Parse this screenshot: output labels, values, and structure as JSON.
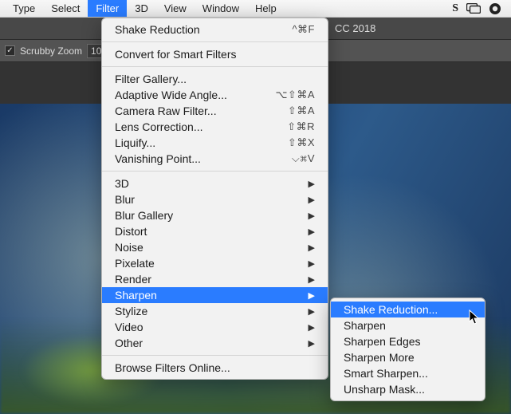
{
  "menubar": {
    "items": [
      "Type",
      "Select",
      "Filter",
      "3D",
      "View",
      "Window",
      "Help"
    ],
    "active_index": 2
  },
  "statusIcons": {
    "s": "S",
    "screens": "screens-icon",
    "cloud": "cc-icon"
  },
  "ps": {
    "title_suffix": "CC 2018",
    "options": {
      "scrubby_label": "Scrubby Zoom",
      "scrubby_checked": true,
      "zoom_value": "10"
    }
  },
  "filterMenu": {
    "sections": [
      {
        "items": [
          {
            "label": "Shake Reduction",
            "shortcut": "^⌘F"
          }
        ]
      },
      {
        "items": [
          {
            "label": "Convert for Smart Filters"
          }
        ]
      },
      {
        "items": [
          {
            "label": "Filter Gallery..."
          },
          {
            "label": "Adaptive Wide Angle...",
            "shortcut": "⌥⇧⌘A"
          },
          {
            "label": "Camera Raw Filter...",
            "shortcut": "⇧⌘A"
          },
          {
            "label": "Lens Correction...",
            "shortcut": "⇧⌘R"
          },
          {
            "label": "Liquify...",
            "shortcut": "⇧⌘X"
          },
          {
            "label": "Vanishing Point...",
            "shortcut": "⌵⌘V"
          }
        ]
      },
      {
        "items": [
          {
            "label": "3D",
            "submenu": true
          },
          {
            "label": "Blur",
            "submenu": true
          },
          {
            "label": "Blur Gallery",
            "submenu": true
          },
          {
            "label": "Distort",
            "submenu": true
          },
          {
            "label": "Noise",
            "submenu": true
          },
          {
            "label": "Pixelate",
            "submenu": true
          },
          {
            "label": "Render",
            "submenu": true
          },
          {
            "label": "Sharpen",
            "submenu": true,
            "highlight": true
          },
          {
            "label": "Stylize",
            "submenu": true
          },
          {
            "label": "Video",
            "submenu": true
          },
          {
            "label": "Other",
            "submenu": true
          }
        ]
      },
      {
        "items": [
          {
            "label": "Browse Filters Online..."
          }
        ]
      }
    ]
  },
  "sharpenSubmenu": {
    "items": [
      {
        "label": "Shake Reduction...",
        "highlight": true
      },
      {
        "label": "Sharpen"
      },
      {
        "label": "Sharpen Edges"
      },
      {
        "label": "Sharpen More"
      },
      {
        "label": "Smart Sharpen..."
      },
      {
        "label": "Unsharp Mask..."
      }
    ]
  }
}
